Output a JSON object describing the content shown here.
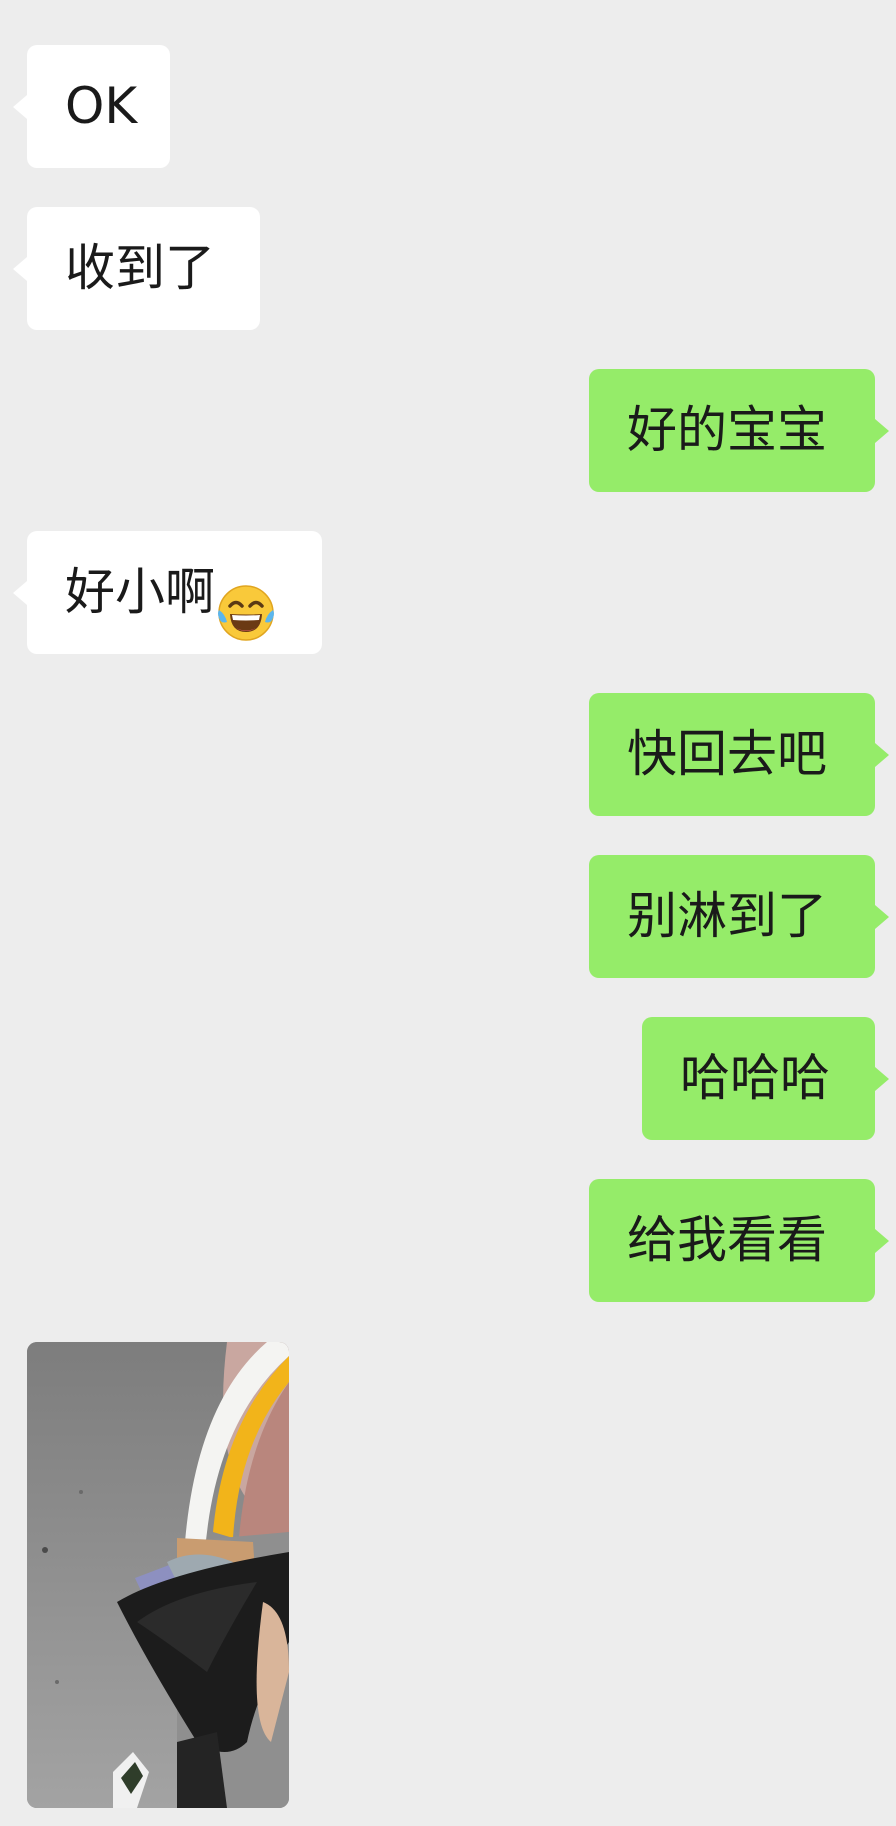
{
  "messages": [
    {
      "side": "in",
      "text": "OK"
    },
    {
      "side": "in",
      "text": "收到了"
    },
    {
      "side": "out",
      "text": "好的宝宝"
    },
    {
      "side": "in",
      "text": "好小啊",
      "emoji": "laughing-crying-emoji"
    },
    {
      "side": "out",
      "text": "快回去吧"
    },
    {
      "side": "out",
      "text": "别淋到了"
    },
    {
      "side": "out",
      "text": "哈哈哈"
    },
    {
      "side": "out",
      "text": "给我看看"
    }
  ],
  "photo": {
    "icon": "photo-bouquet",
    "colors": {
      "road": "#8b8b8b",
      "curb": "#f4f4f2",
      "yellow": "#f2b41a",
      "wrap": "#1b1b1b"
    }
  },
  "colors": {
    "background": "#ededed",
    "incoming_bubble": "#ffffff",
    "outgoing_bubble": "#95ec69",
    "text": "#1a1a1a"
  }
}
